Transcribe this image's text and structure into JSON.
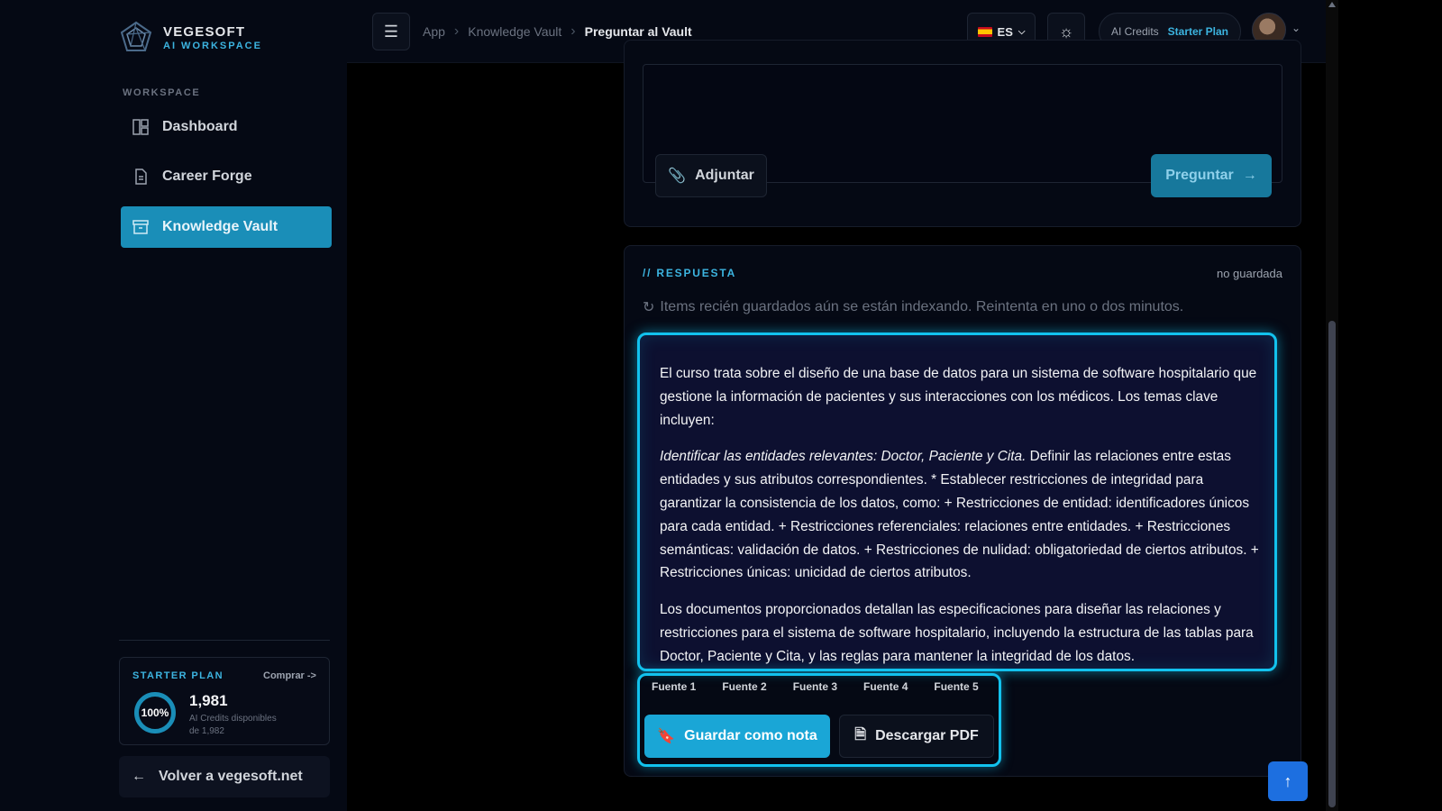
{
  "brand": {
    "name": "VEGESOFT",
    "sub": "AI WORKSPACE"
  },
  "sidebar": {
    "section_label": "WORKSPACE",
    "items": [
      {
        "label": "Dashboard",
        "icon": "dashboard-icon"
      },
      {
        "label": "Career Forge",
        "icon": "document-icon"
      },
      {
        "label": "Knowledge Vault",
        "icon": "archive-icon",
        "active": true
      }
    ],
    "plan": {
      "title": "STARTER PLAN",
      "buy": "Comprar ->",
      "percent": "100%",
      "credits": "1,981",
      "desc": "AI Credits disponibles",
      "of": "de 1,982"
    },
    "back": "Volver a vegesoft.net"
  },
  "header": {
    "breadcrumbs": [
      "App",
      "Knowledge Vault",
      "Preguntar al Vault"
    ],
    "lang": "ES",
    "credits_label": "AI Credits",
    "plan_label": "Starter Plan"
  },
  "ask": {
    "attach": "Adjuntar",
    "submit": "Preguntar"
  },
  "answer": {
    "title": "// RESPUESTA",
    "status": "no guardada",
    "notice": "Items recién guardados aún se están indexando. Reintenta en uno o dos minutos.",
    "p1": "El curso trata sobre el diseño de una base de datos para un sistema de software hospitalario que gestione la información de pacientes y sus interacciones con los médicos. Los temas clave incluyen:",
    "p2_em": "Identificar las entidades relevantes: Doctor, Paciente y Cita.",
    "p2_rest": " Definir las relaciones entre estas entidades y sus atributos correspondientes. * Establecer restricciones de integridad para garantizar la consistencia de los datos, como: + Restricciones de entidad: identificadores únicos para cada entidad. + Restricciones referenciales: relaciones entre entidades. + Restricciones semánticas: validación de datos. + Restricciones de nulidad: obligatoriedad de ciertos atributos. + Restricciones únicas: unicidad de ciertos atributos.",
    "p3": "Los documentos proporcionados detallan las especificaciones para diseñar las relaciones y restricciones para el sistema de software hospitalario, incluyendo la estructura de las tablas para Doctor, Paciente y Cita, y las reglas para mantener la integridad de los datos.",
    "sources": [
      "Fuente 1",
      "Fuente 2",
      "Fuente 3",
      "Fuente 4",
      "Fuente 5"
    ],
    "save": "Guardar como nota",
    "pdf": "Descargar PDF"
  },
  "colors": {
    "accent": "#1aa6d6",
    "highlight": "#12c2ee",
    "bg": "#050914"
  }
}
